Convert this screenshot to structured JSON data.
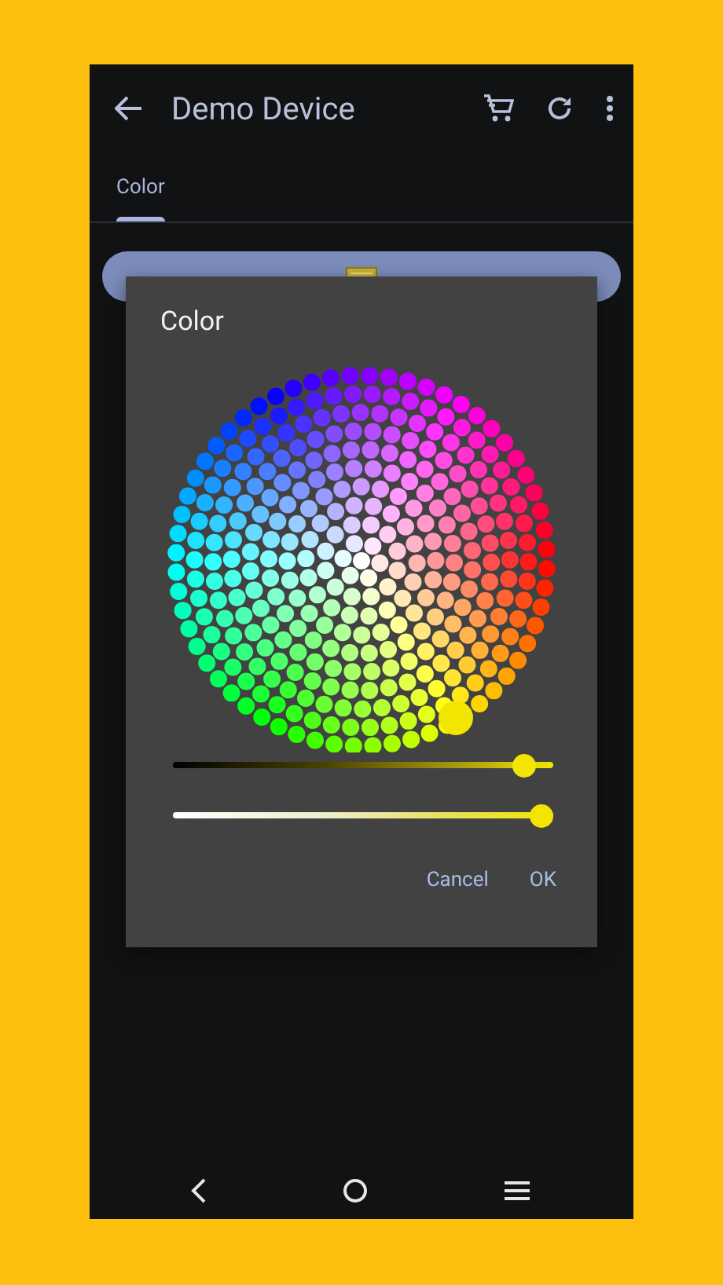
{
  "app_bar": {
    "title": "Demo Device"
  },
  "tabs": [
    {
      "label": "Color",
      "selected": true
    }
  ],
  "color_button": {
    "kind": "light"
  },
  "dialog": {
    "title": "Color",
    "sliders": [
      {
        "kind": "brightness",
        "level": 0.95
      },
      {
        "kind": "saturation",
        "level": 1
      }
    ],
    "buttons": [
      "Cancel",
      "OK"
    ]
  }
}
